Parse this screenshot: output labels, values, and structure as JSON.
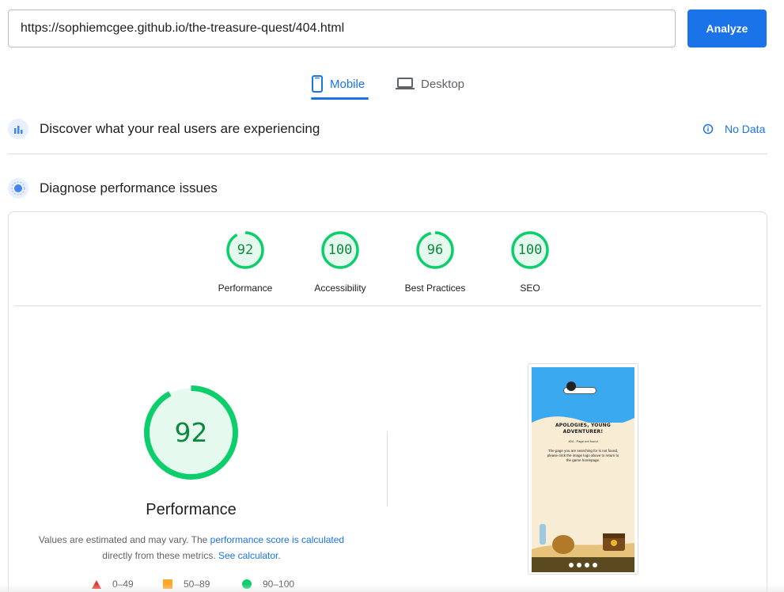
{
  "search": {
    "url_value": "https://sophiemcgee.github.io/the-treasure-quest/404.html",
    "analyze_label": "Analyze"
  },
  "tabs": [
    {
      "label": "Mobile",
      "icon": "smartphone-icon",
      "active": true
    },
    {
      "label": "Desktop",
      "icon": "laptop-icon",
      "active": false
    }
  ],
  "field_data": {
    "title": "Discover what your real users are experiencing",
    "status": "No Data",
    "icon": "users-chart-icon"
  },
  "diagnose": {
    "title": "Diagnose performance issues",
    "icon": "lighthouse-icon"
  },
  "scores": [
    {
      "label": "Performance",
      "value": "92"
    },
    {
      "label": "Accessibility",
      "value": "100"
    },
    {
      "label": "Best Practices",
      "value": "96"
    },
    {
      "label": "SEO",
      "value": "100"
    }
  ],
  "performance": {
    "score": "92",
    "title": "Performance",
    "disclaimer_prefix": "Values are estimated and may vary. The ",
    "disclaimer_link": "performance score is calculated",
    "disclaimer_middle": " directly from these metrics. ",
    "calculator_link": "See calculator",
    "disclaimer_suffix": "."
  },
  "legend": [
    {
      "range": "0–49",
      "color": "#e53935",
      "shape": "triangle"
    },
    {
      "range": "50–89",
      "color": "#ffa726",
      "shape": "square"
    },
    {
      "range": "90–100",
      "color": "#0cce6b",
      "shape": "circle"
    }
  ],
  "screenshot": {
    "heading": "APOLOGIES, YOUNG ADVENTURER!",
    "sub": "404 - Page not found",
    "body": "The page you are searching for is not found, please click the image logo above to return to the game homepage."
  },
  "colors": {
    "accent": "#1a73e8",
    "pass": "#0cce6b",
    "pass_text": "#0c8a3c"
  }
}
